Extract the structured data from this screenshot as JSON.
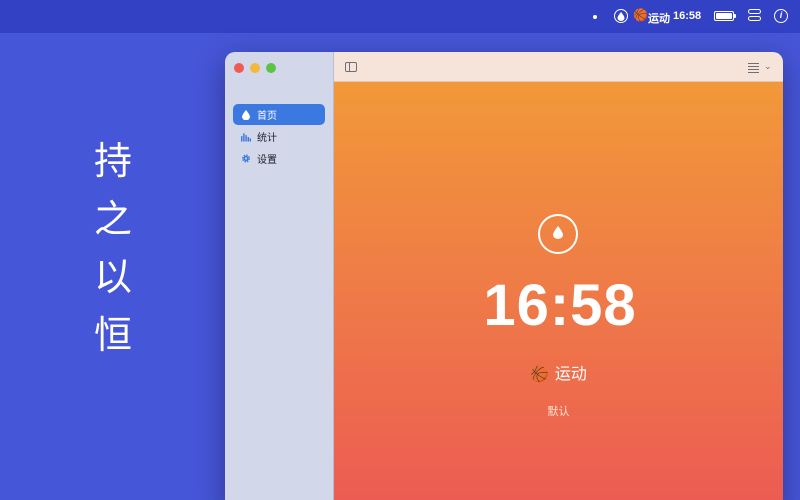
{
  "menubar": {
    "activity_emoji": "🏀",
    "activity_label": "运动",
    "time": "16:58",
    "info_glyph": "i"
  },
  "slogan": [
    "持",
    "之",
    "以",
    "恒"
  ],
  "sidebar": {
    "items": [
      {
        "label": "首页",
        "icon": "drop-icon",
        "active": true
      },
      {
        "label": "统计",
        "icon": "bar-chart-icon",
        "active": false
      },
      {
        "label": "设置",
        "icon": "gear-icon",
        "active": false
      }
    ]
  },
  "main": {
    "time": "16:58",
    "activity_emoji": "🏀",
    "activity_label": "运动",
    "sub_label": "默认"
  },
  "colors": {
    "desktop": "#4656d8",
    "accent": "#3b79e0",
    "gradient_top": "#f29839",
    "gradient_bottom": "#ec5a53"
  }
}
